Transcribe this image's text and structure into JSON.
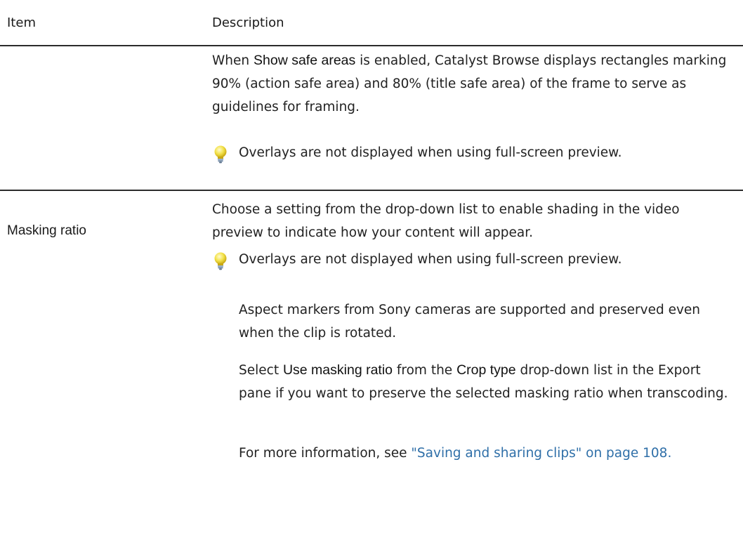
{
  "header": {
    "item": "Item",
    "description": "Description"
  },
  "row1": {
    "item": "",
    "desc_pre": "When ",
    "desc_bold": "Show safe areas",
    "desc_post": " is enabled, Catalyst Browse displays rectangles marking 90% (action safe area) and 80% (title safe area) of the frame to serve as guidelines for framing.",
    "tip": "Overlays are not displayed when using full-screen preview."
  },
  "row2": {
    "item": "Masking ratio",
    "desc": "Choose a setting from the drop-down list to enable shading in the video preview to indicate how your content will appear.",
    "tip": "Overlays are not displayed when using full-screen preview.",
    "note1": "Aspect markers from Sony cameras are supported and preserved even when the clip is rotated.",
    "note2_pre": "Select ",
    "note2_bold1": "Use masking ratio",
    "note2_mid": " from the ",
    "note2_bold2": "Crop type",
    "note2_post": " drop-down list in the Export pane if you want to preserve the selected masking ratio when transcoding.",
    "note3_pre": "For more information, see ",
    "note3_link": "\"Saving and sharing clips\" on page 108."
  },
  "icons": {
    "tip": "lightbulb-icon"
  },
  "colors": {
    "link": "#2f6fa8",
    "rule": "#2b2b2b"
  }
}
